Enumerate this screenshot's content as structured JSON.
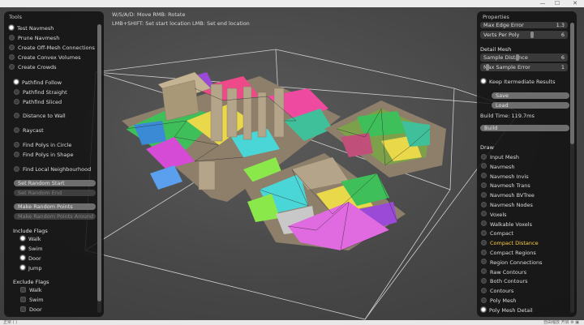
{
  "window": {
    "min": "—",
    "max": "☐",
    "close": "✕"
  },
  "hints": {
    "line1": "W/S/A/D: Move  RMB: Rotate",
    "line2": "LMB+SHIFT: Set start location  LMB: Set end location"
  },
  "tools": {
    "title": "Tools",
    "items": [
      {
        "label": "Test Navmesh",
        "checked": true
      },
      {
        "label": "Prune Navmesh",
        "checked": false
      },
      {
        "label": "Create Off-Mesh Connections",
        "checked": false
      },
      {
        "label": "Create Convex Volumes",
        "checked": false
      },
      {
        "label": "Create Crowds",
        "checked": false
      }
    ],
    "modes": [
      {
        "label": "Pathfind Follow",
        "checked": true
      },
      {
        "label": "Pathfind Straight",
        "checked": false
      },
      {
        "label": "Pathfind Sliced",
        "checked": false
      },
      {
        "label": "Distance to Wall",
        "checked": false
      },
      {
        "label": "Raycast",
        "checked": false
      },
      {
        "label": "Find Polys in Circle",
        "checked": false
      },
      {
        "label": "Find Polys in Shape",
        "checked": false
      },
      {
        "label": "Find Local Neighbourhood",
        "checked": false
      }
    ],
    "buttons": {
      "set_random_start": "Set Random Start",
      "set_random_end": "Set Random End",
      "make_random_points": "Make Random Points",
      "make_random_points_around": "Make Random Points Around"
    },
    "include_flags": {
      "title": "Include Flags",
      "items": [
        {
          "label": "Walk",
          "checked": true
        },
        {
          "label": "Swim",
          "checked": true
        },
        {
          "label": "Door",
          "checked": true
        },
        {
          "label": "Jump",
          "checked": true
        }
      ]
    },
    "exclude_flags": {
      "title": "Exclude Flags",
      "items": [
        {
          "label": "Walk",
          "checked": false
        },
        {
          "label": "Swim",
          "checked": false
        },
        {
          "label": "Door",
          "checked": false
        }
      ]
    }
  },
  "properties": {
    "title": "Properties",
    "max_edge_error": {
      "label": "Max Edge Error",
      "value": "1.3"
    },
    "verts_per_poly": {
      "label": "Verts Per Poly",
      "value": "6"
    },
    "detail_mesh": "Detail Mesh",
    "sample_distance": {
      "label": "Sample Distance",
      "value": "6"
    },
    "max_sample_error": {
      "label": "Max Sample Error",
      "value": "1"
    },
    "keep_intermediate": {
      "label": "Keep Itermediate Results",
      "checked": true
    },
    "save": "Save",
    "load": "Load",
    "build_time": "Build Time: 119.7ms",
    "build": "Build",
    "draw_title": "Draw",
    "draw_items": [
      {
        "label": "Input Mesh",
        "checked": false
      },
      {
        "label": "Navmesh",
        "checked": false
      },
      {
        "label": "Navmesh Invis",
        "checked": false
      },
      {
        "label": "Navmesh Trans",
        "checked": false
      },
      {
        "label": "Navmesh BVTree",
        "checked": false
      },
      {
        "label": "Navmesh Nodes",
        "checked": false
      },
      {
        "label": "Voxels",
        "checked": false
      },
      {
        "label": "Walkable Voxels",
        "checked": false
      },
      {
        "label": "Compact",
        "checked": false
      },
      {
        "label": "Compact Distance",
        "checked": false,
        "highlight": true
      },
      {
        "label": "Compact Regions",
        "checked": false
      },
      {
        "label": "Region Connections",
        "checked": false
      },
      {
        "label": "Raw Contours",
        "checked": false
      },
      {
        "label": "Both Contours",
        "checked": false
      },
      {
        "label": "Contours",
        "checked": false
      },
      {
        "label": "Poly Mesh",
        "checked": false
      },
      {
        "label": "Poly Mesh Detail",
        "checked": true
      }
    ]
  },
  "status": {
    "left": "正常 ( )",
    "right": "自由缩放 开启 ⚙ ▣"
  }
}
